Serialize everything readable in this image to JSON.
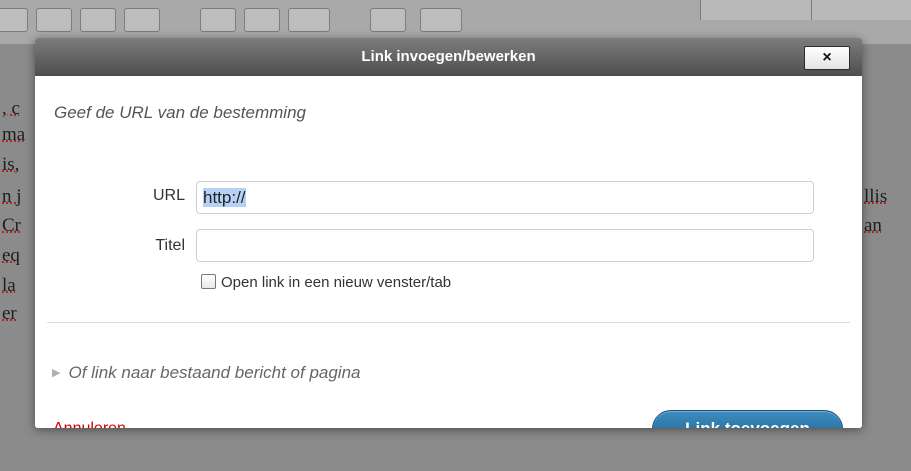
{
  "dialog": {
    "title": "Link invoegen/bewerken",
    "close_label": "×",
    "instruction": "Geef de URL van de bestemming",
    "url_label": "URL",
    "url_value": "http://",
    "title_label": "Titel",
    "title_value": "",
    "new_window_label": "Open link in een nieuw venster/tab",
    "existing_content_label": "Of link naar bestaand bericht of pagina",
    "cancel_label": "Annuleren",
    "submit_label": "Link toevoegen"
  },
  "background": {
    "left_lines": [
      ", c",
      "ma",
      "is,",
      "n j",
      "Cr",
      "eq",
      "la ",
      "er"
    ],
    "right_lines": [
      "llis",
      "an"
    ]
  },
  "colors": {
    "title_bar": "#5a5a5a",
    "primary_button": "#2672a5",
    "cancel_link": "#d10000",
    "selection": "#b5d2f6"
  }
}
